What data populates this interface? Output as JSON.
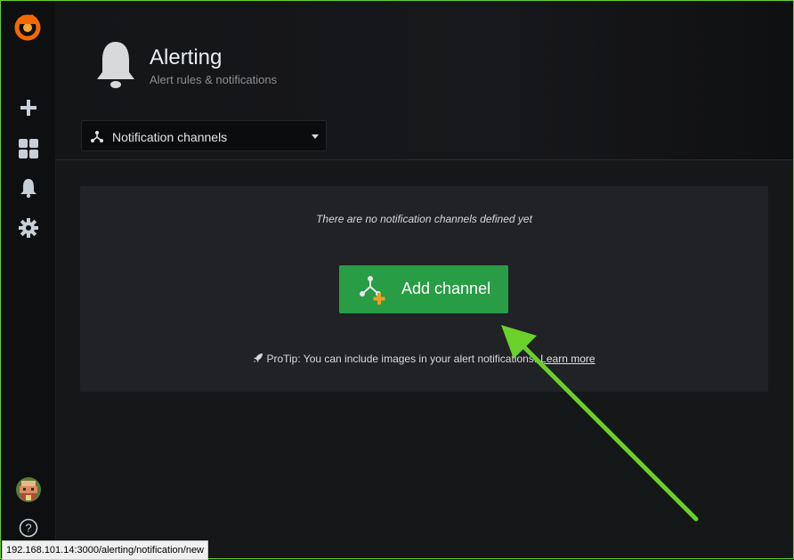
{
  "header": {
    "title": "Alerting",
    "subtitle": "Alert rules & notifications"
  },
  "nav": {
    "selected": "Notification channels"
  },
  "empty_state": {
    "message": "There are no notification channels defined yet",
    "button_label": "Add channel",
    "protip_text": "ProTip: You can include images in your alert notifications.",
    "learn_more": "Learn more"
  },
  "status_bar": {
    "url": "192.168.101.14:3000/alerting/notification/new"
  },
  "colors": {
    "accent_green": "#299c46",
    "annotation_arrow": "#6ad02a",
    "logo_orange": "#f46800"
  },
  "icons": {
    "logo": "grafana-logo-icon",
    "sidebar": [
      "plus-icon",
      "dashboards-icon",
      "bell-icon",
      "gear-icon"
    ],
    "avatar": "avatar",
    "help": "help-icon"
  }
}
